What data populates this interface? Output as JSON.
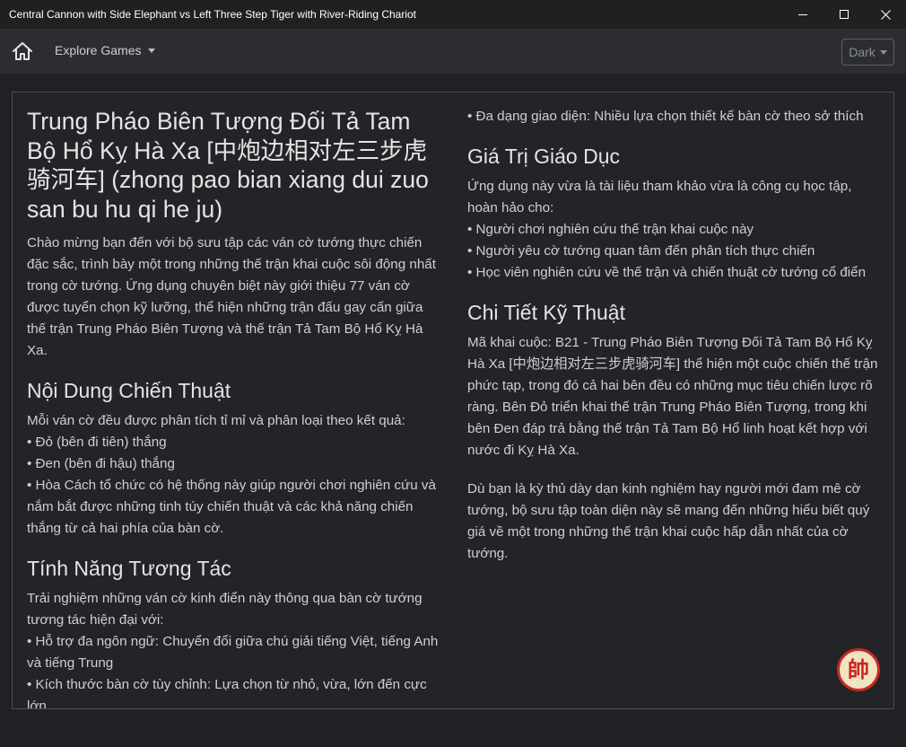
{
  "window": {
    "title": "Central Cannon with Side Elephant vs Left Three Step Tiger with River-Riding Chariot"
  },
  "navbar": {
    "home_icon": "home-icon",
    "explore_label": "Explore Games",
    "theme_label": "Dark"
  },
  "content": {
    "title": "Trung Pháo Biên Tượng Đối Tả Tam Bộ Hổ Kỵ Hà Xa [中炮边相对左三步虎骑河车] (zhong pao bian xiang dui zuo san bu hu qi he ju)",
    "intro": "Chào mừng bạn đến với bộ sưu tập các ván cờ tướng thực chiến đặc sắc, trình bày một trong những thế trận khai cuộc sôi động nhất trong cờ tướng. Ứng dụng chuyên biệt này giới thiệu 77 ván cờ được tuyển chọn kỹ lưỡng, thể hiện những trận đấu gay cấn giữa thế trận Trung Pháo Biên Tượng và thế trận Tả Tam Bộ Hổ Kỵ Hà Xa.",
    "tactics": {
      "heading": "Nội Dung Chiến Thuật",
      "lead": "Mỗi ván cờ đều được phân tích tỉ mỉ và phân loại theo kết quả:",
      "items": [
        "• Đỏ (bên đi tiên) thắng",
        "• Đen (bên đi hậu) thắng",
        "• Hòa Cách tổ chức có hệ thống này giúp người chơi nghiên cứu và nắm bắt được những tinh túy chiến thuật và các khả năng chiến thắng từ cả hai phía của bàn cờ."
      ]
    },
    "features": {
      "heading": "Tính Năng Tương Tác",
      "lead": "Trải nghiệm những ván cờ kinh điển này thông qua bàn cờ tướng tương tác hiện đại với:",
      "items": [
        "• Hỗ trợ đa ngôn ngữ: Chuyển đổi giữa chú giải tiếng Việt, tiếng Anh và tiếng Trung",
        "• Kích thước bàn cờ tùy chỉnh: Lựa chọn từ nhỏ, vừa, lớn đến cực lớn",
        "• Đa dạng giao diện: Nhiều lựa chọn thiết kế bàn cờ theo sở thích"
      ]
    },
    "education": {
      "heading": "Giá Trị Giáo Dục",
      "lead": "Ứng dụng này vừa là tài liệu tham khảo vừa là công cụ học tập, hoàn hảo cho:",
      "items": [
        "• Người chơi nghiên cứu thế trận khai cuộc này",
        "• Người yêu cờ tướng quan tâm đến phân tích thực chiến",
        "• Học viên nghiên cứu về thế trận và chiến thuật cờ tướng cổ điển"
      ]
    },
    "technical": {
      "heading": "Chi Tiết Kỹ Thuật",
      "body": "Mã khai cuộc: B21 - Trung Pháo Biên Tượng Đối Tả Tam Bộ Hổ Kỵ Hà Xa [中炮边相对左三步虎骑河车] thể hiện một cuộc chiến thế trận phức tạp, trong đó cả hai bên đều có những mục tiêu chiến lược rõ ràng. Bên Đỏ triển khai thế trận Trung Pháo Biên Tượng, trong khi bên Đen đáp trả bằng thế trận Tả Tam Bộ Hổ linh hoạt kết hợp với nước đi Kỵ Hà Xa.",
      "closing": "Dù bạn là kỳ thủ dày dạn kinh nghiệm hay người mới đam mê cờ tướng, bộ sưu tập toàn diện này sẽ mang đến những hiểu biết quý giá về một trong những thế trận khai cuộc hấp dẫn nhất của cờ tướng."
    },
    "seal_char": "帥"
  }
}
